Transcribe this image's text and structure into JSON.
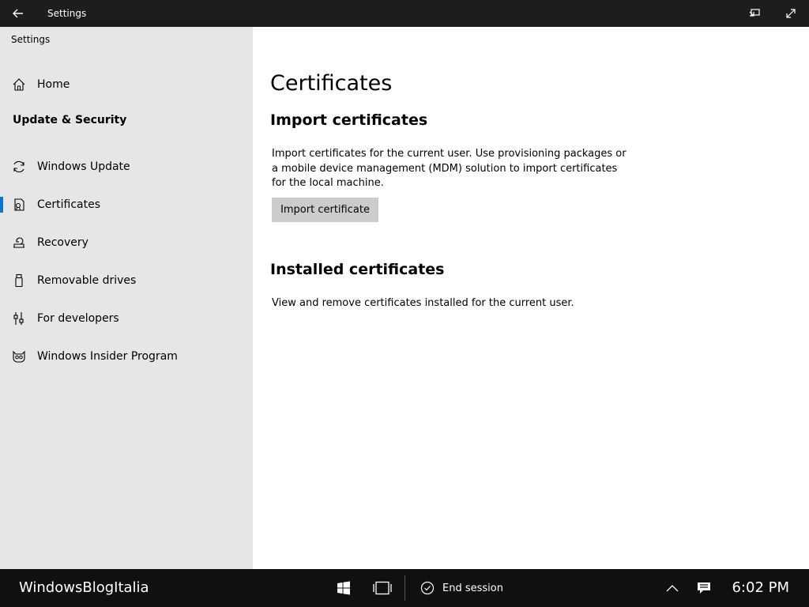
{
  "titlebar": {
    "title": "Settings",
    "back_icon": "back-arrow-icon",
    "right_icons": [
      "tablet-mode-icon",
      "expand-icon"
    ]
  },
  "sidebar": {
    "app_label": "Settings",
    "home": {
      "label": "Home",
      "icon": "home-icon"
    },
    "section_title": "Update & Security",
    "items": [
      {
        "label": "Windows Update",
        "icon": "refresh-icon",
        "selected": false
      },
      {
        "label": "Certificates",
        "icon": "certificate-icon",
        "selected": true
      },
      {
        "label": "Recovery",
        "icon": "recovery-icon",
        "selected": false
      },
      {
        "label": "Removable drives",
        "icon": "usb-drive-icon",
        "selected": false
      },
      {
        "label": "For developers",
        "icon": "developer-tools-icon",
        "selected": false
      },
      {
        "label": "Windows Insider Program",
        "icon": "insider-cat-icon",
        "selected": false
      }
    ],
    "accent_color": "#0078d7"
  },
  "main": {
    "page_title": "Certificates",
    "import": {
      "heading": "Import certificates",
      "description": "Import certificates for the current user. Use provisioning packages or a mobile device management (MDM) solution to import certificates for the local machine.",
      "button_label": "Import certificate"
    },
    "installed": {
      "heading": "Installed certificates",
      "description": "View and remove certificates installed for the current user."
    }
  },
  "taskbar": {
    "brand": "WindowsBlogItalia",
    "start_icon": "windows-logo-icon",
    "task_view_icon": "task-view-icon",
    "end_session_icon": "check-circle-icon",
    "end_session_label": "End session",
    "tray_icons": [
      "chevron-up-icon",
      "notification-icon"
    ],
    "clock": "6:02 PM"
  }
}
